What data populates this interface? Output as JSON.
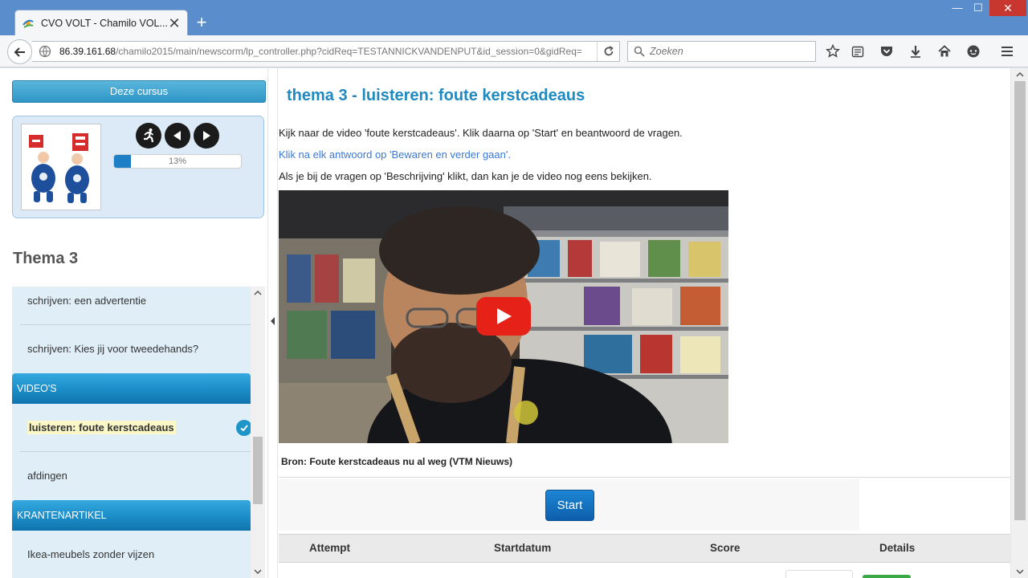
{
  "browser": {
    "tab_title": "CVO VOLT - Chamilo VOL...",
    "url_domain": "86.39.161.68",
    "url_path": "/chamilo2015/main/newscorm/lp_controller.php?cidReq=TESTANNICKVANDENPUT&id_session=0&gidReq=",
    "search_placeholder": "Zoeken",
    "newtab_symbol": "+",
    "close_symbol": "✕",
    "min_symbol": "—",
    "max_symbol": "☐"
  },
  "sidebar": {
    "course_button": "Deze cursus",
    "progress": {
      "percent_value": 13,
      "label": "13%"
    },
    "theme_title": "Thema 3",
    "items": [
      {
        "label": "schrijven: een advertentie",
        "type": "item"
      },
      {
        "label": "schrijven: Kies jij voor tweedehands?",
        "type": "item"
      },
      {
        "label": "VIDEO'S",
        "type": "header"
      },
      {
        "label": "luisteren: foute kerstcadeaus",
        "type": "item",
        "current": true,
        "completed": true
      },
      {
        "label": "afdingen",
        "type": "item"
      },
      {
        "label": "KRANTENARTIKEL",
        "type": "header"
      },
      {
        "label": "Ikea-meubels zonder vijzen",
        "type": "item"
      }
    ]
  },
  "main": {
    "title": "thema 3 - luisteren: foute kerstcadeaus",
    "paragraph1": "Kijk naar de video 'foute kerstcadeaus'. Klik daarna op 'Start' en beantwoord de vragen.",
    "paragraph2": "Klik na elk antwoord op 'Bewaren en verder gaan'.",
    "paragraph3": "Als je bij de vragen op 'Beschrijving' klikt, dan kan je de video nog eens bekijken.",
    "source": "Bron: Foute kerstcadeaus nu al weg (VTM Nieuws)",
    "start_button": "Start",
    "table_headers": [
      "Attempt",
      "Startdatum",
      "Score",
      "Details"
    ]
  },
  "colors": {
    "accent": "#1e8ac0",
    "link": "#3a79d6",
    "header_blue": "#1d8fca",
    "window_frame": "#5a8dcb",
    "youtube_red": "#e62117"
  }
}
